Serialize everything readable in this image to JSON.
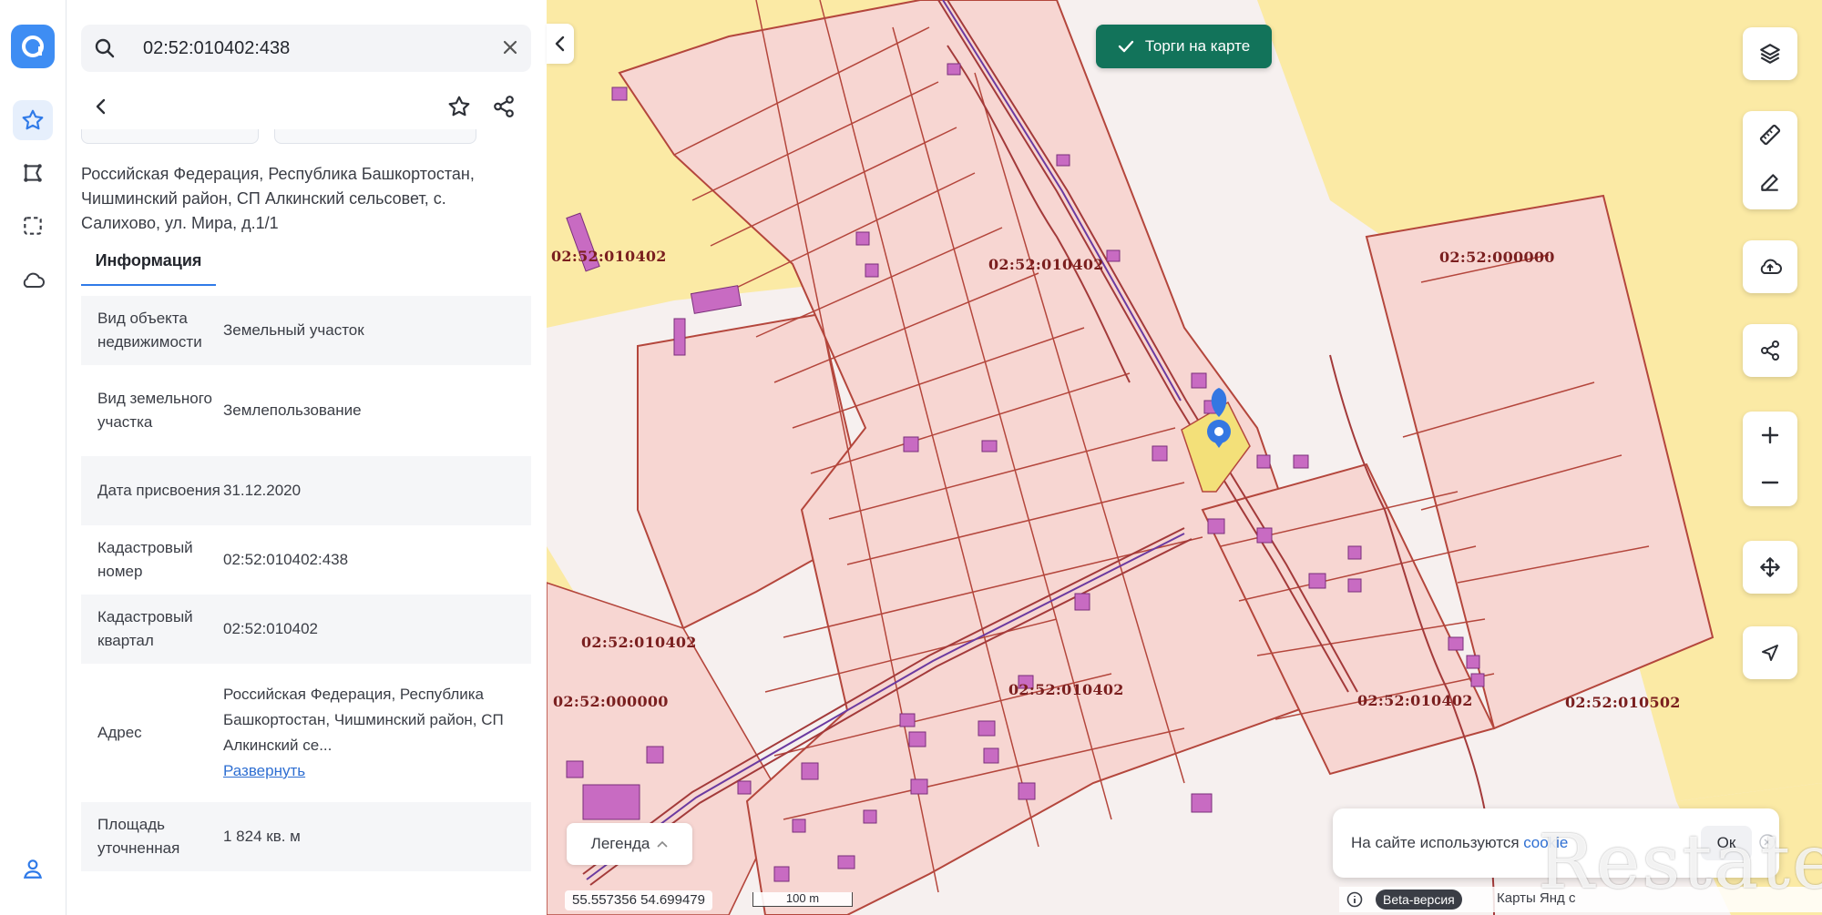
{
  "colors": {
    "accent": "#3e8df3",
    "auction": "#12735a",
    "parcel_fill": "#f7d6d2",
    "parcel_stroke": "#b4463c",
    "zone_yellow": "#fbeaa5",
    "building": "#c86bc2",
    "selected": "#f3e079",
    "pin": "#3477e2"
  },
  "rail": {
    "logo": "logo-icon",
    "items": [
      {
        "name": "star-icon",
        "active": true
      },
      {
        "name": "polygon-icon",
        "active": false
      },
      {
        "name": "select-area-icon",
        "active": false
      },
      {
        "name": "cloud-icon",
        "active": false
      }
    ],
    "bottom": "user-icon"
  },
  "panel": {
    "search_query": "02:52:010402:438",
    "address": "Российская Федерация, Республика Башкортостан, Чишминский район, СП Алкинский сельсовет, с. Салихово, ул. Мира, д.1/1",
    "tab_label": "Информация",
    "rows": [
      {
        "key": "Вид объекта недвижимости",
        "value": "Земельный участок"
      },
      {
        "key": "Вид земельного участка",
        "value": "Землепользование"
      },
      {
        "key": "Дата присвоения",
        "value": "31.12.2020"
      },
      {
        "key": "Кадастровый номер",
        "value": "02:52:010402:438"
      },
      {
        "key": "Кадастровый квартал",
        "value": "02:52:010402"
      },
      {
        "key": "Адрес",
        "value": "Российская Федерация, Республика Башкортостан, Чишминский район, СП Алкинский се...",
        "link": "Развернуть"
      },
      {
        "key": "Площадь уточненная",
        "value": "1 824 кв. м"
      }
    ]
  },
  "map": {
    "auction_label": "Торги на карте",
    "labels": [
      "02:52:010402",
      "02:52:010402",
      "02:52:000000",
      "02:52:010402",
      "02:52:000000",
      "02:52:010402",
      "02:52:010402",
      "02:52:010502"
    ],
    "legend_label": "Легенда",
    "coords": "55.557356  54.699479",
    "scale": "100 m",
    "cookie_text": "На сайте используются ",
    "cookie_link": "cookie",
    "cookie_ok": "Ок",
    "footer_beta": "Beta-версия",
    "footer_text": "Карты  Янд  с  ",
    "watermark": "Restate"
  }
}
